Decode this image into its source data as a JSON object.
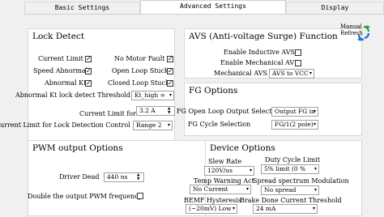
{
  "tabs": [
    "Basic Settings",
    "Advanced Settings",
    "Display"
  ],
  "lock_detect": {
    "title": "Lock Detect",
    "current_limit": "Current Limit",
    "no_motor_fault": "No Motor Fault",
    "speed_abnormal": "Speed Abnormal",
    "open_loop_stuck": "Open Loop Stuck",
    "abnormal_kt": "Abnormal Kt",
    "closed_loop_stuck": "Closed Loop Stuck",
    "abnormal_kt_threshold_label": "Abnormal Kt lock detect Threshold",
    "abnormal_kt_threshold_value": "Kt_high =",
    "current_limit_for_lock_label": "Current Limit for Lock",
    "current_limit_for_lock_value": "3.2 A",
    "current_limit_range_label": "urrent Limit for Lock Detection Control",
    "current_limit_range_value": "Range 2"
  },
  "avs": {
    "title": "AVS (Anti-voltage Surge) Function",
    "enable_inductive": "Enable Inductive AVS",
    "enable_mechanical": "Enable Mechanical AVS",
    "mode_label": "Mechanical AVS Mode",
    "mode_value": "AVS to VCC"
  },
  "fg": {
    "title": "FG Options",
    "open_loop_select_label": "FG Open Loop Output Select",
    "open_loop_select_value": "Output FG in",
    "cycle_label": "FG Cycle Selection",
    "cycle_value": "FG/1(2 pole)"
  },
  "pwm": {
    "title": "PWM output Options",
    "driver_dead_label": "Driver Dead",
    "driver_dead_value": "440 ns",
    "double_freq_label": "Double the output PWM frequency"
  },
  "device": {
    "title": "Device Options",
    "slew_rate_label": "Slew Rate",
    "slew_rate_value": "120V/us",
    "duty_cycle_limit_label": "Duty Cycle Limit",
    "duty_cycle_limit_value": "5% limit (0 %",
    "temp_warning_label": "Temp Warning Act",
    "temp_warning_value": "No Current",
    "spread_spectrum_label": "Spread spectrum Modulation",
    "spread_spectrum_value": "No spread",
    "bemf_hysteresis_label": "BEMF Hysteresis",
    "bemf_hysteresis_value": "(~20mV) Low",
    "brake_done_label": "Brake Done Current Threshold",
    "brake_done_value": "24 mA"
  },
  "manual_refresh": [
    "Manual",
    "Refresh"
  ],
  "colors": {
    "accent_green": "#2e9e3e",
    "accent_blue": "#1a6fd1"
  }
}
